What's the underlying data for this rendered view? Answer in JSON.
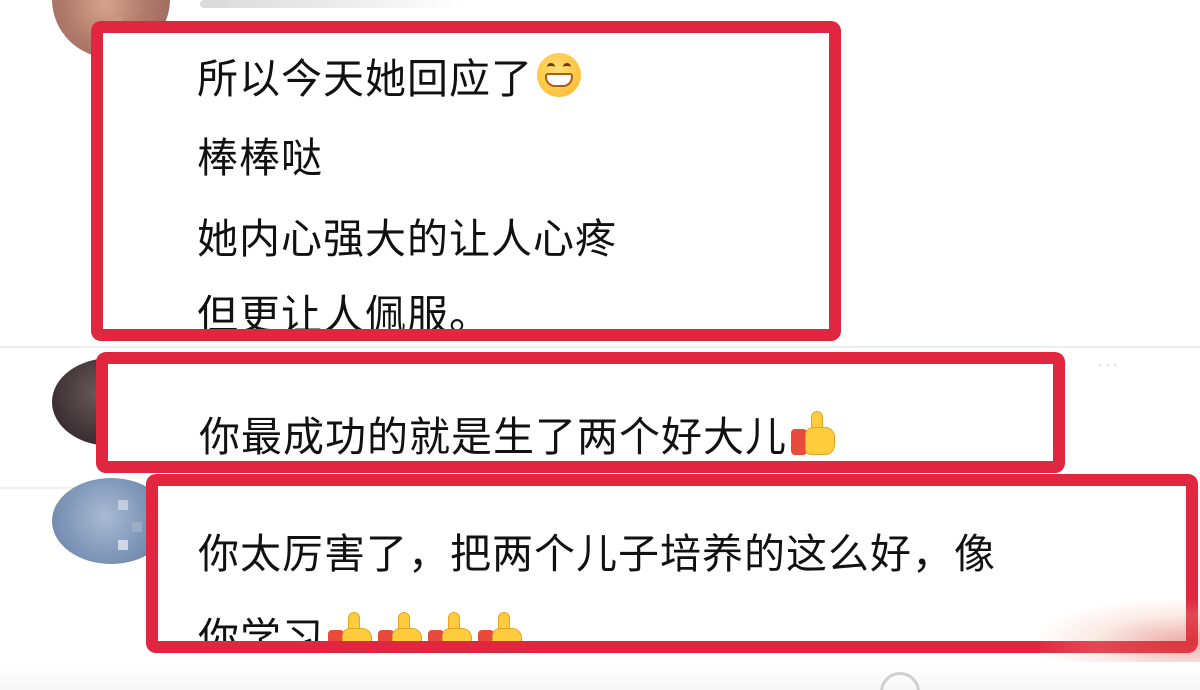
{
  "colors": {
    "highlight_border": "#e0273f",
    "text": "#111111",
    "background": "#ffffff"
  },
  "comments": [
    {
      "avatar_icon": "avatar-blurred",
      "lines": [
        "所以今天她回应了",
        "棒棒哒",
        "她内心强大的让人心疼",
        "但更让人佩服。"
      ],
      "emoji_icon": "grinning-face-icon"
    },
    {
      "avatar_icon": "avatar-blurred",
      "lines": [
        "你最成功的就是生了两个好大儿"
      ],
      "emoji_icon": "thumbs-up-icon"
    },
    {
      "avatar_icon": "avatar-blurred",
      "lines": [
        "你太厉害了，把两个儿子培养的这么好，像",
        "你学习"
      ],
      "emoji_icon": "thumbs-up-icon",
      "emoji_count": 4
    }
  ],
  "footer": {
    "like_icon": "heart-outline-icon"
  }
}
